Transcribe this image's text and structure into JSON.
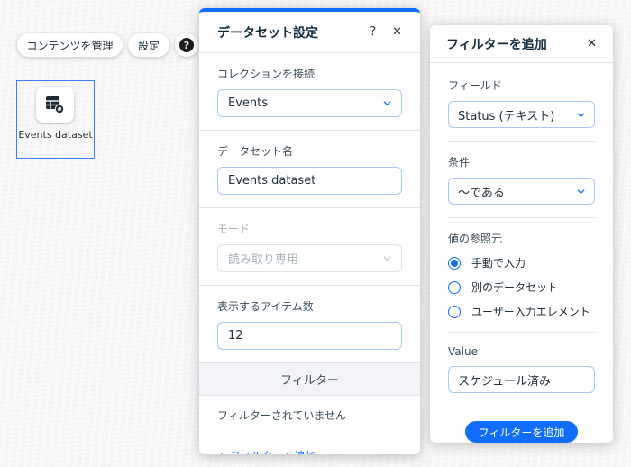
{
  "toolbar": {
    "manage_content": "コンテンツを管理",
    "settings": "設定",
    "help": "?"
  },
  "canvas": {
    "dataset_label": "Events dataset"
  },
  "dataset_panel": {
    "title": "データセット設定",
    "help": "?",
    "close": "✕",
    "collection_label": "コレクションを接続",
    "collection_value": "Events",
    "dataset_name_label": "データセット名",
    "dataset_name_value": "Events dataset",
    "mode_label": "モード",
    "mode_value": "読み取り専用",
    "items_label": "表示するアイテム数",
    "items_value": "12",
    "filters_header": "フィルター",
    "no_filters": "フィルターされていません",
    "add_filter_link": "+ フィルターを追加"
  },
  "filter_panel": {
    "title": "フィルターを追加",
    "close": "✕",
    "field_label": "フィールド",
    "field_value": "Status (テキスト)",
    "condition_label": "条件",
    "condition_value": "〜である",
    "source_label": "値の参照元",
    "source_options": [
      "手動で入力",
      "別のデータセット",
      "ユーザー入力エレメント"
    ],
    "selected_source": "手動で入力",
    "value_label": "Value",
    "value_value": "スケジュール済み",
    "submit": "フィルターを追加"
  },
  "colors": {
    "accent": "#116dff",
    "selection": "#3b7cf7"
  }
}
